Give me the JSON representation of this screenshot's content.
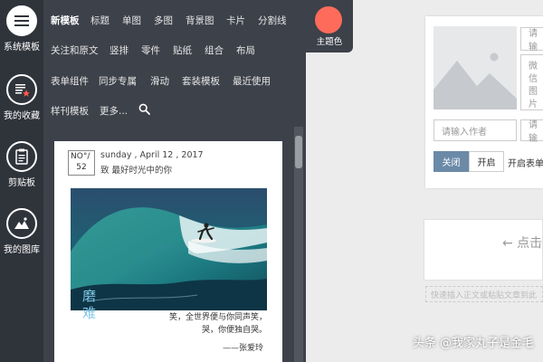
{
  "sidebar": {
    "items": [
      {
        "label": "系统模板",
        "icon": "list-icon"
      },
      {
        "label": "我的收藏",
        "icon": "favorites-icon"
      },
      {
        "label": "剪贴板",
        "icon": "clipboard-icon"
      },
      {
        "label": "我的图库",
        "icon": "image-icon"
      }
    ]
  },
  "menu": {
    "rows": [
      [
        "新模板",
        "标题",
        "单图",
        "多图",
        "背景图",
        "卡片",
        "分割线"
      ],
      [
        "关注和原文",
        "竖排",
        "零件",
        "贴纸",
        "组合",
        "布局"
      ],
      [
        "表单组件",
        "同步专属",
        "滑动",
        "套装模板",
        "最近使用"
      ],
      [
        "样刊模板",
        "更多..."
      ]
    ]
  },
  "theme": {
    "label": "主题色",
    "color": "#ff6b5a"
  },
  "preview": {
    "date_top": "NO°/",
    "date_num": "52",
    "date_line": "sunday , April 12 , 2017",
    "greeting": "致  最好时光中的你",
    "overlay_word_1": "磨",
    "overlay_word_2": "难",
    "quote_1": "笑，全世界便与你同声笑，",
    "quote_2": "哭，你便独自哭。",
    "author": "——张爱玲"
  },
  "right_panel": {
    "input_1_placeholder": "请输",
    "input_2_line1": "微信",
    "input_2_line2": "图片",
    "author_placeholder": "请输入作者",
    "input_4_placeholder": "请输",
    "btn_off": "关闭",
    "btn_on": "开启",
    "form_label": "开启表单",
    "click_hint": "← 点击",
    "paste_hint": "快速插入正文或粘贴文章到此"
  },
  "watermark": "头条 @我家丸子是金毛"
}
